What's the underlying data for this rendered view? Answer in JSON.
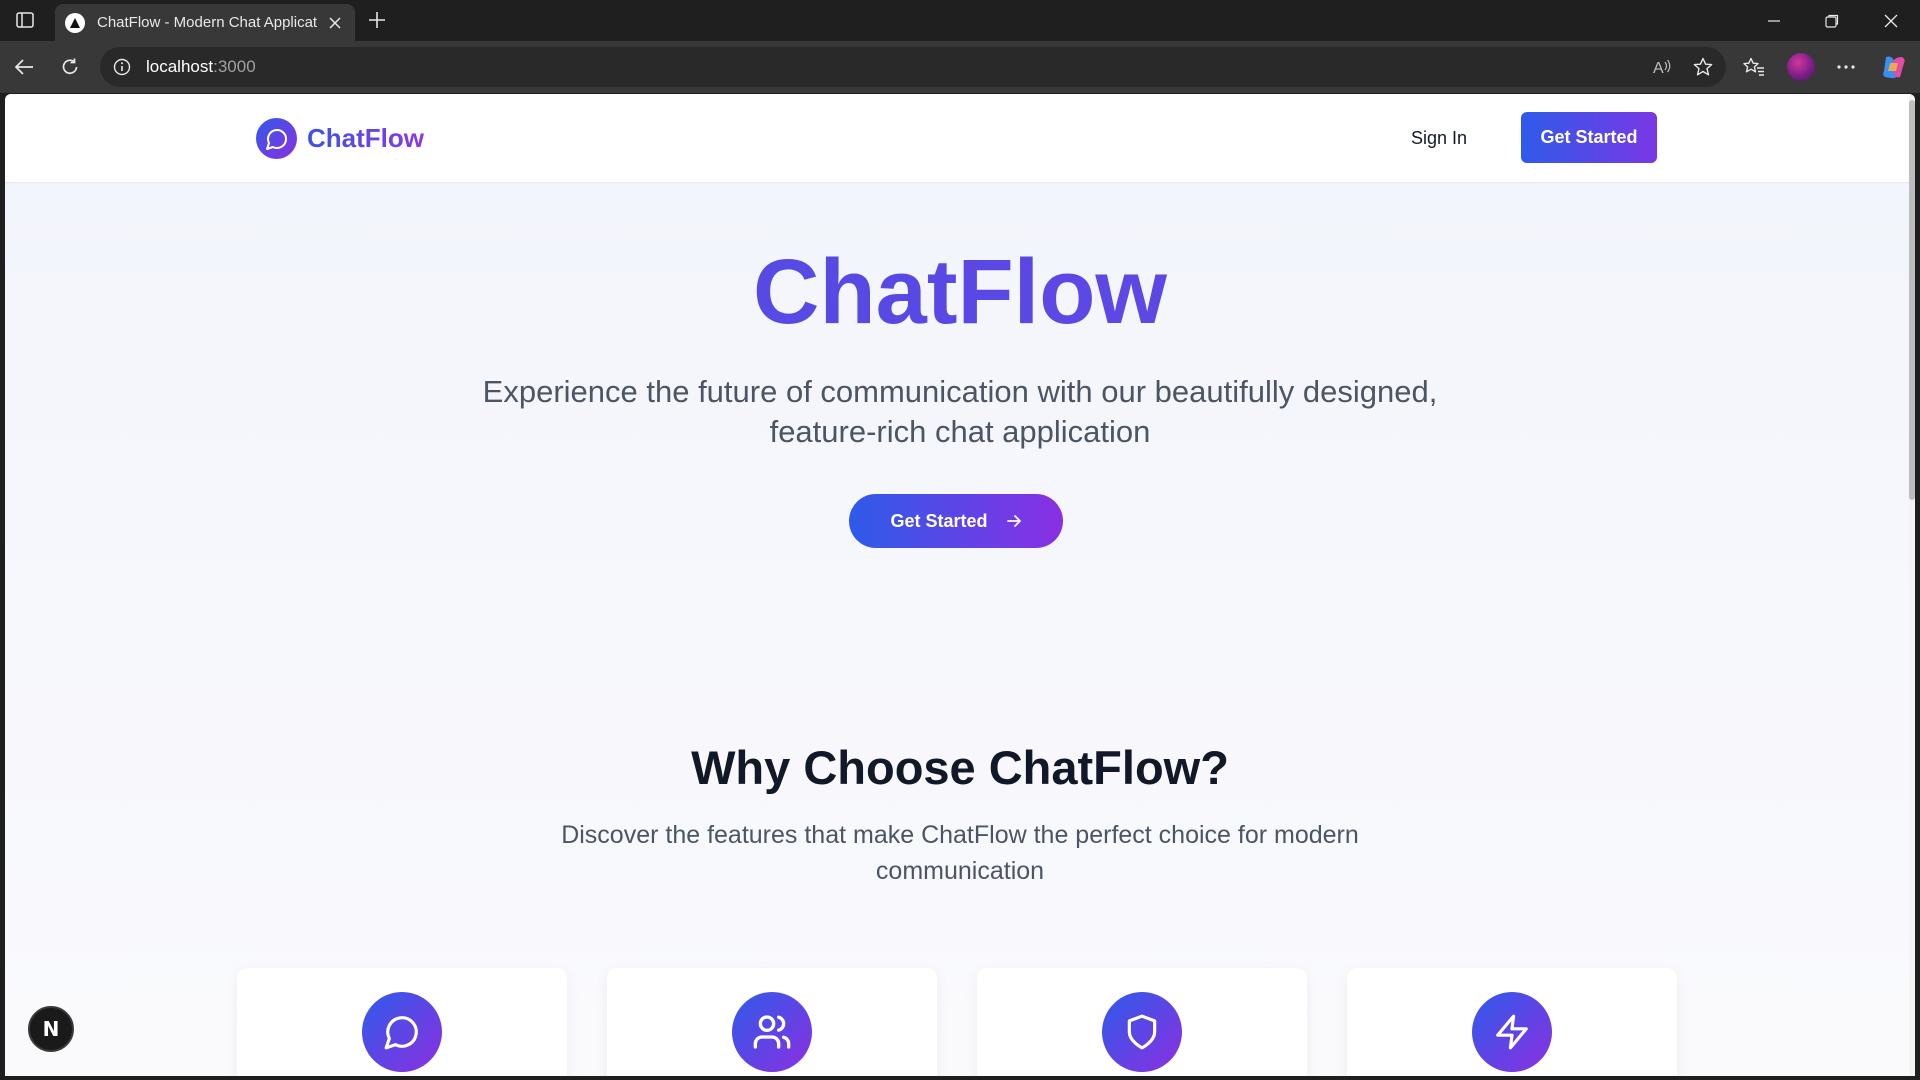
{
  "browser": {
    "tab_title": "ChatFlow - Modern Chat Applicat",
    "url_host": "localhost",
    "url_port": ":3000"
  },
  "header": {
    "brand": "ChatFlow",
    "sign_in": "Sign In",
    "cta": "Get Started"
  },
  "hero": {
    "title": "ChatFlow",
    "subtitle": "Experience the future of communication with our beautifully designed, feature-rich chat application",
    "cta": "Get Started"
  },
  "features": {
    "title": "Why Choose ChatFlow?",
    "subtitle": "Discover the features that make ChatFlow the perfect choice for modern communication",
    "cards": [
      {
        "icon": "message-circle-icon"
      },
      {
        "icon": "users-icon"
      },
      {
        "icon": "shield-icon"
      },
      {
        "icon": "zap-icon"
      }
    ]
  },
  "dev_badge": {
    "label": "N"
  },
  "colors": {
    "accent_start": "#2f5bea",
    "accent_end": "#8b2fe0",
    "heading": "#111827",
    "body_text": "#4b5563"
  }
}
